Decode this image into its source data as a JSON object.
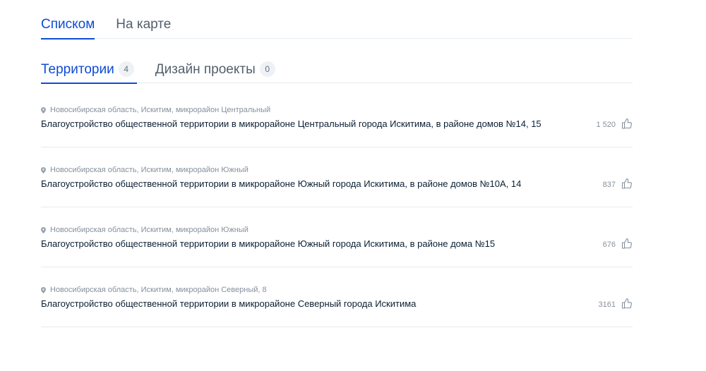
{
  "view_tabs": [
    {
      "label": "Списком",
      "active": true
    },
    {
      "label": "На карте",
      "active": false
    }
  ],
  "category_tabs": [
    {
      "label": "Территории",
      "count": "4",
      "active": true
    },
    {
      "label": "Дизайн проекты",
      "count": "0",
      "active": false
    }
  ],
  "items": [
    {
      "address": "Новосибирская область, Искитим, микрорайон Центральный",
      "title": "Благоустройство общественной территории в микрорайоне Центральный города Искитима, в районе домов №14, 15",
      "likes": "1 520"
    },
    {
      "address": "Новосибирская область, Искитим, микрорайон Южный",
      "title": "Благоустройство общественной территории в микрорайоне Южный города Искитима, в районе домов №10А, 14",
      "likes": "837"
    },
    {
      "address": "Новосибирская область, Искитим, микрорайон Южный",
      "title": "Благоустройство общественной территории в микрорайоне Южный города Искитима, в районе дома №15",
      "likes": "676"
    },
    {
      "address": "Новосибирская область, Искитим, микрорайон Северный, 8",
      "title": "Благоустройство общественной территории в микрорайоне Северный города Искитима",
      "likes": "3161"
    }
  ],
  "icons": {
    "location": "location-pin-icon",
    "like": "thumbs-up-icon"
  },
  "colors": {
    "accent": "#0d4cd3",
    "muted": "#86909c",
    "divider": "#e4ecf1"
  }
}
